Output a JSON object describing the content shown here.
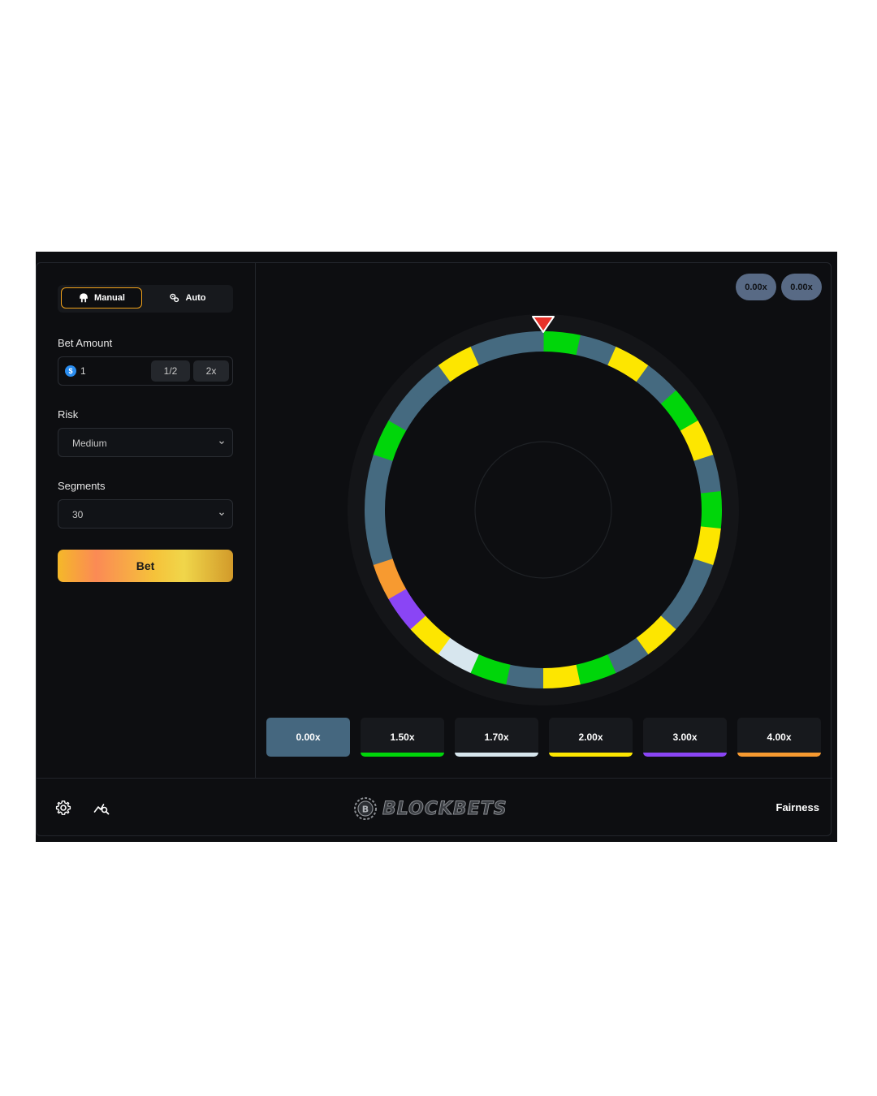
{
  "sidebar": {
    "modes": [
      {
        "label": "Manual",
        "icon": "manual-icon",
        "active": true
      },
      {
        "label": "Auto",
        "icon": "auto-icon",
        "active": false
      }
    ],
    "bet_amount": {
      "label": "Bet Amount",
      "currency_icon": "$",
      "value": "1",
      "half_label": "1/2",
      "double_label": "2x"
    },
    "risk": {
      "label": "Risk",
      "value": "Medium"
    },
    "segments": {
      "label": "Segments",
      "value": "30"
    },
    "bet_button": "Bet"
  },
  "history": [
    "0.00x",
    "0.00x"
  ],
  "wheel": {
    "segment_count": 30,
    "pointer_color": "#e8322a",
    "colors": {
      "g": "#39485a",
      "G": "#00d60a",
      "Y": "#fde600",
      "P": "#8a45f5",
      "W": "#d7e6ee",
      "O": "#f79a30"
    },
    "segments": [
      "G",
      "g",
      "Y",
      "g",
      "G",
      "Y",
      "g",
      "G",
      "Y",
      "g",
      "g",
      "Y",
      "g",
      "G",
      "Y",
      "g",
      "G",
      "W",
      "Y",
      "P",
      "O",
      "g",
      "g",
      "g",
      "G",
      "g",
      "g",
      "Y",
      "g",
      "g"
    ]
  },
  "multipliers": [
    {
      "label": "0.00x",
      "color": "#45677f",
      "selected": true
    },
    {
      "label": "1.50x",
      "color": "#00d60a",
      "selected": false
    },
    {
      "label": "1.70x",
      "color": "#d7e6ee",
      "selected": false
    },
    {
      "label": "2.00x",
      "color": "#fde600",
      "selected": false
    },
    {
      "label": "3.00x",
      "color": "#8a45f5",
      "selected": false
    },
    {
      "label": "4.00x",
      "color": "#f79a30",
      "selected": false
    }
  ],
  "footer": {
    "settings_icon": "gear-icon",
    "stats_icon": "chart-search-icon",
    "brand": "BLOCKBETS",
    "fairness": "Fairness"
  }
}
